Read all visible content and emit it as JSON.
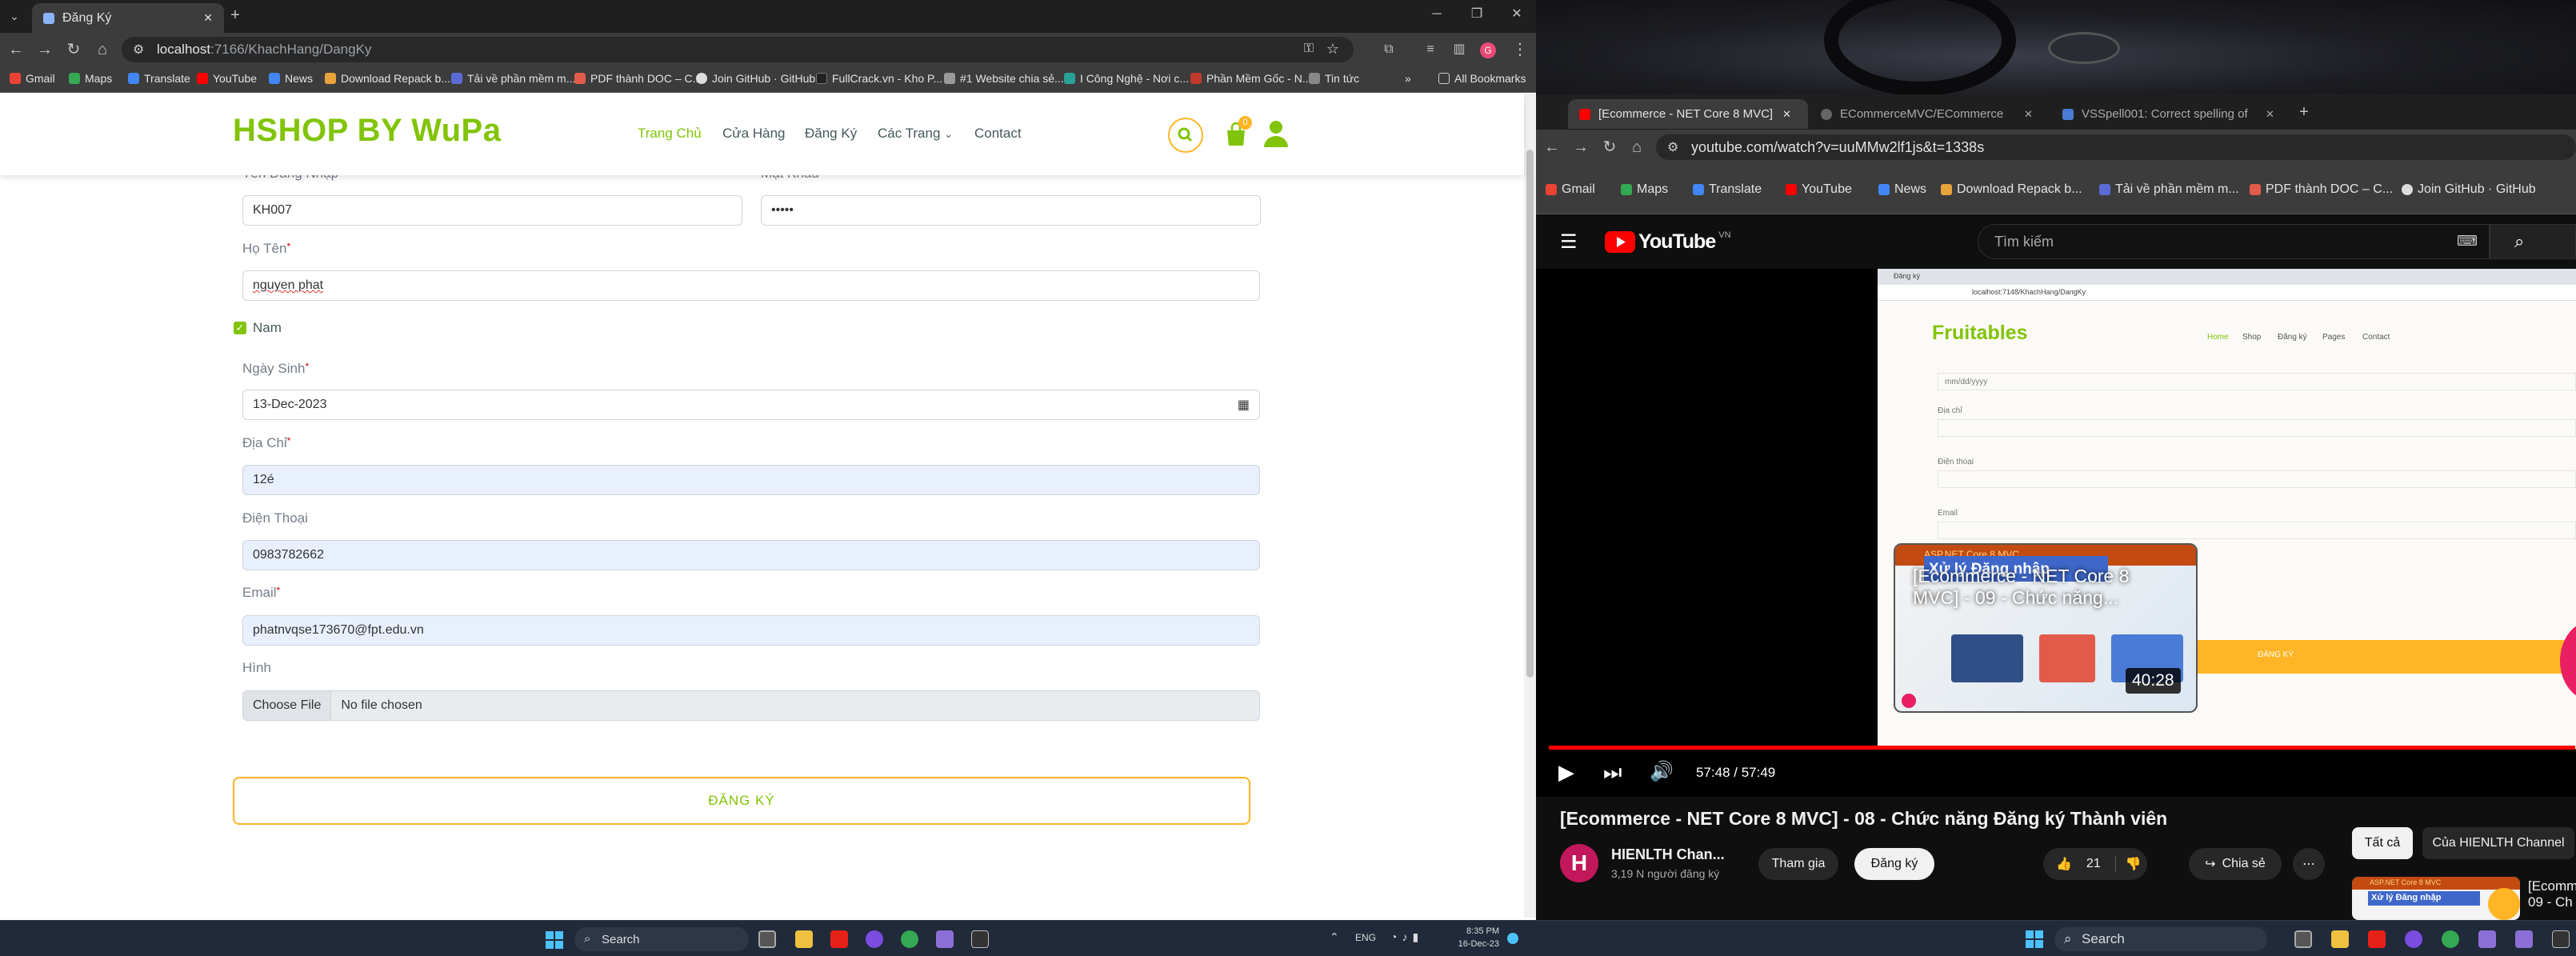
{
  "left_browser": {
    "tab_title": "Đăng Ký",
    "url_host": "localhost",
    "url_rest": ":7166/KhachHang/DangKy",
    "bookmarks": [
      "Gmail",
      "Maps",
      "Translate",
      "YouTube",
      "News",
      "Download Repack b...",
      "Tải về phần mềm m...",
      "PDF thành DOC – C...",
      "Join GitHub · GitHub",
      "FullCrack.vn - Kho P...",
      "#1 Website chia sẻ...",
      "I Công Nghệ - Nơi c...",
      "Phần Mềm Gốc - N...",
      "Tin tức"
    ],
    "all_bookmarks": "All Bookmarks",
    "profile_badge": "G"
  },
  "site": {
    "logo": "HSHOP BY WuPa",
    "nav": [
      "Trang Chủ",
      "Cửa Hàng",
      "Đăng Ký",
      "Các Trang",
      "Contact"
    ],
    "cart_count": "0"
  },
  "form": {
    "username_label": "Tên Đăng Nhập",
    "username_value": "KH007",
    "password_label": "Mật Khẩu",
    "password_value": "•••••",
    "fullname_label": "Họ Tên",
    "fullname_value": "nguyen phat",
    "gender_label": "Nam",
    "dob_label": "Ngày Sinh",
    "dob_value": "13-Dec-2023",
    "address_label": "Địa Chỉ",
    "address_value": "12é",
    "phone_label": "Điện Thoại",
    "phone_value": "0983782662",
    "email_label": "Email",
    "email_value": "phatnvqse173670@fpt.edu.vn",
    "image_label": "Hình",
    "choose_file": "Choose File",
    "no_file": "No file chosen",
    "submit": "ĐĂNG KÝ",
    "required_mark": "*"
  },
  "taskbar_left": {
    "search": "Search",
    "lang": "ENG",
    "time": "8:35 PM",
    "date": "16-Dec-23"
  },
  "right_browser": {
    "tabs": [
      "[Ecommerce - NET Core 8 MVC]",
      "ECommerceMVC/ECommerce",
      "VSSpell001: Correct spelling of"
    ],
    "url": "youtube.com/watch?v=uuMMw2lf1js&t=1338s",
    "bookmarks": [
      "Gmail",
      "Maps",
      "Translate",
      "YouTube",
      "News",
      "Download Repack b...",
      "Tải về phần mềm m...",
      "PDF thành DOC – C...",
      "Join GitHub · GitHub"
    ]
  },
  "youtube": {
    "logo": "YouTube",
    "region": "VN",
    "search_placeholder": "Tìm kiếm",
    "time": "57:48 / 57:49",
    "progress": 0.999,
    "video_title": "[Ecommerce - NET Core 8 MVC] - 08 - Chức năng Đăng ký Thành viên",
    "channel": "HIENLTH Chan...",
    "subs": "3,19 N người đăng ký",
    "join": "Tham gia",
    "subscribe": "Đăng ký",
    "likes": "21",
    "share": "Chia sẻ",
    "chip_all": "Tất cả",
    "chip_channel": "Của HIENLTH Channel",
    "next_title": "[Ecommerce - NET Core 8 MVC] - 09 - Chức năng...",
    "next_badge": "Xử lý Đăng nhập",
    "next_duration": "40:28",
    "next_tag": "ASP.NET Core 8 MVC",
    "side_badge": "Xử lý Đăng nhập",
    "side_tag": "ASP.NET Core 8 MVC",
    "side_title": "[Ecomm 09 - Ch",
    "inner": {
      "url": "localhost:7148/KhachHang/DangKy",
      "logo": "Fruitables",
      "nav": [
        "Home",
        "Shop",
        "Đăng ký",
        "Pages",
        "Contact"
      ],
      "date_ph": "mm/dd/yyyy",
      "labels": [
        "Địa chỉ",
        "Điện thoại",
        "Email"
      ],
      "submit": "ĐĂNG KÝ",
      "tab": "Đăng ký"
    }
  },
  "taskbar_right": {
    "search": "Search"
  }
}
